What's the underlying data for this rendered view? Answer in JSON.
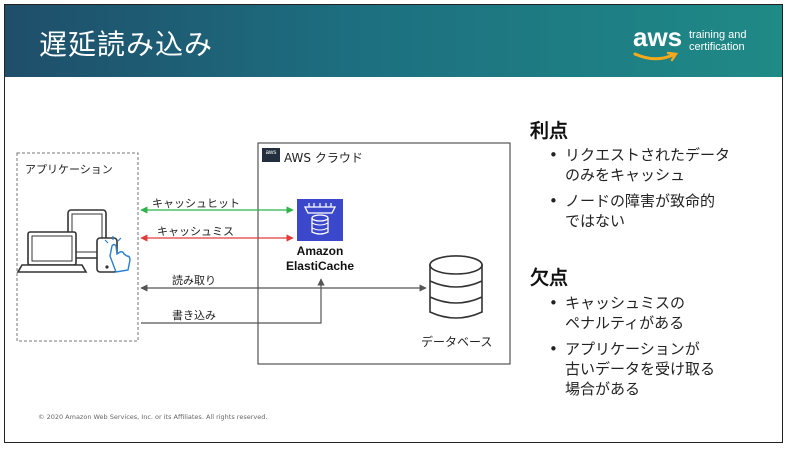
{
  "slide": {
    "title": "遅延読み込み",
    "logo": {
      "word": "aws",
      "line1": "training and",
      "line2": "certification"
    },
    "footer": "© 2020 Amazon Web Services, Inc. or its Affiliates. All rights reserved."
  },
  "diagram": {
    "app_label": "アプリケーション",
    "cloud_badge": "aws",
    "cloud_label": "AWS クラウド",
    "service_name_1": "Amazon",
    "service_name_2": "ElastiCache",
    "database_label": "データベース",
    "flows": {
      "cache_hit": "キャッシュヒット",
      "cache_miss": "キャッシュミス",
      "read": "読み取り",
      "write": "書き込み"
    }
  },
  "pros": {
    "heading": "利点",
    "items": [
      "リクエストされたデータ",
      "のみをキャッシュ",
      "ノードの障害が致命的",
      "ではない"
    ]
  },
  "cons": {
    "heading": "欠点",
    "items": [
      "キャッシュミスの",
      "ペナルティがある",
      "アプリケーションが",
      "古いデータを受け取る",
      "場合がある"
    ]
  },
  "colors": {
    "header_start": "#1f4e6a",
    "header_end": "#1f8a86",
    "cache_hit_arrow": "#2db34a",
    "cache_miss_arrow": "#e03c3c",
    "elasticache_blue": "#3b48cc"
  },
  "icons": [
    "laptop-icon",
    "tablet-icon",
    "phone-icon",
    "touch-hand-icon",
    "elasticache-icon",
    "database-icon",
    "aws-smile-icon"
  ]
}
